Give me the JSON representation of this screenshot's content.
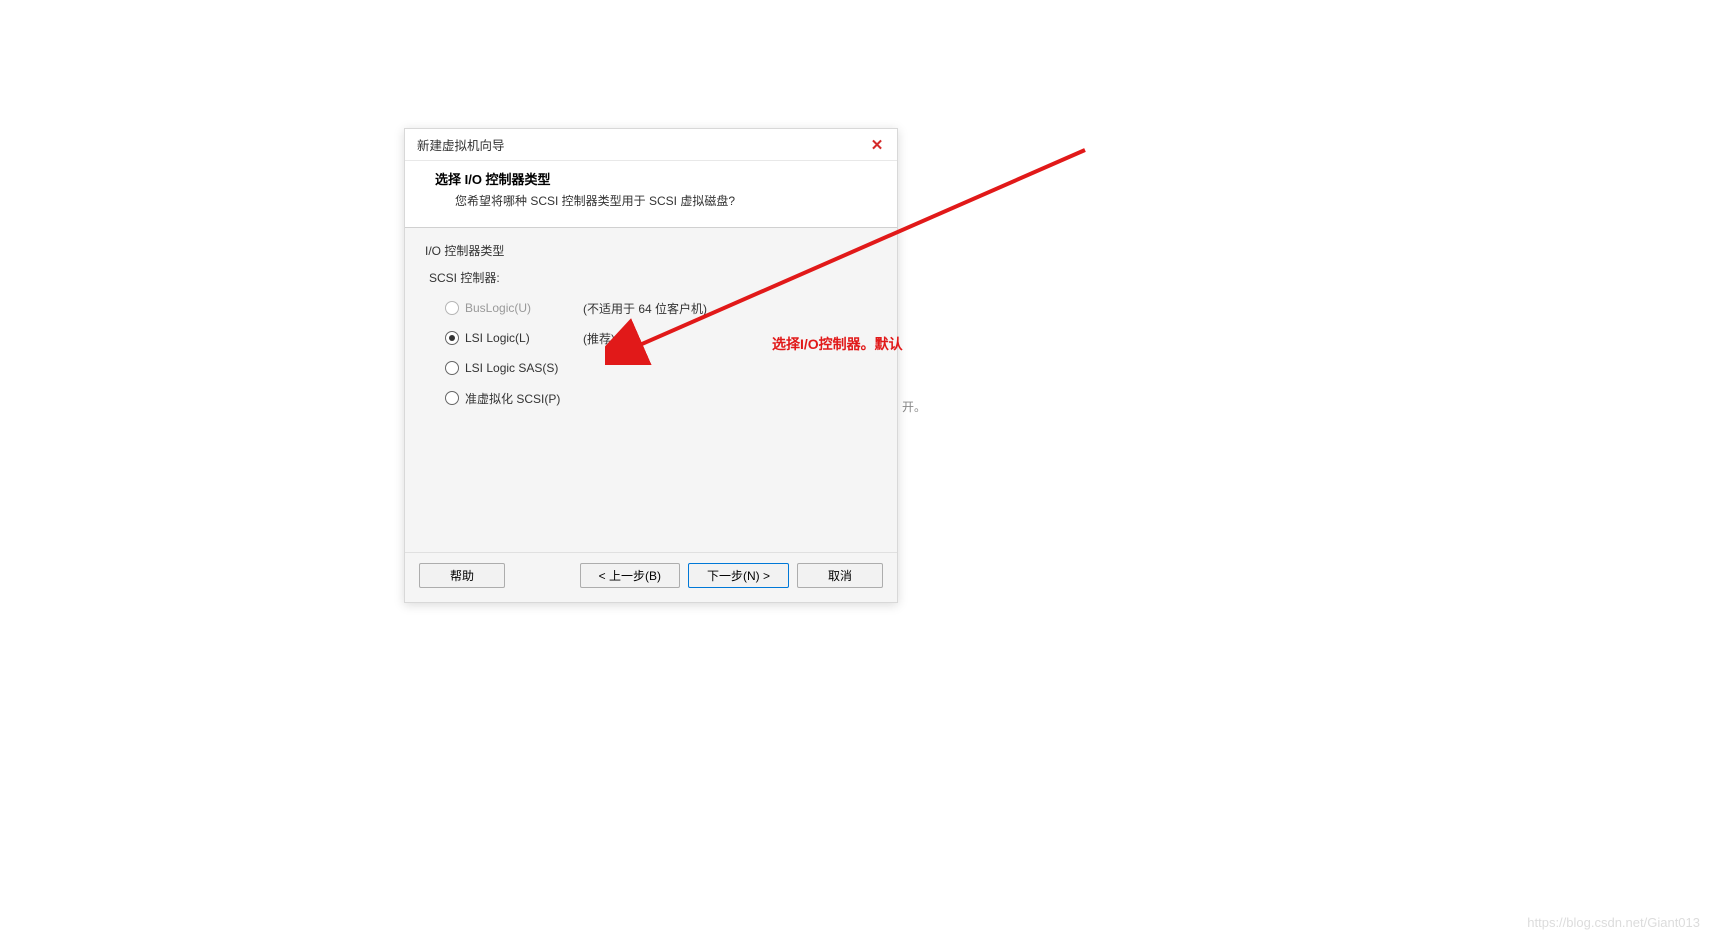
{
  "dialog": {
    "title": "新建虚拟机向导",
    "close": "✕",
    "header_title": "选择 I/O 控制器类型",
    "header_subtitle": "您希望将哪种 SCSI 控制器类型用于 SCSI 虚拟磁盘?",
    "section_label": "I/O 控制器类型",
    "sub_label": "SCSI 控制器:",
    "options": {
      "buslogic": {
        "label": "BusLogic(U)",
        "note": "(不适用于 64 位客户机)"
      },
      "lsilogic": {
        "label": "LSI Logic(L)",
        "note": "(推荐)"
      },
      "lsisas": {
        "label": "LSI Logic SAS(S)",
        "note": ""
      },
      "pvscsi": {
        "label": "准虚拟化 SCSI(P)",
        "note": ""
      }
    },
    "buttons": {
      "help": "帮助",
      "back": "< 上一步(B)",
      "next": "下一步(N) >",
      "cancel": "取消"
    }
  },
  "annotation": "选择I/O控制器。默认",
  "bg_fragment": "开。",
  "watermark": "https://blog.csdn.net/Giant013"
}
